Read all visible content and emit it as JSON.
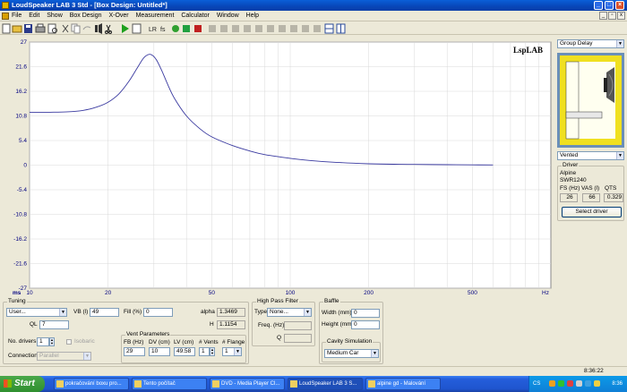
{
  "window": {
    "title": "LoudSpeaker LAB 3 Std - [Box Design: Untitled*]"
  },
  "menu": [
    "File",
    "Edit",
    "Show",
    "Box Design",
    "X-Over",
    "Measurement",
    "Calculator",
    "Window",
    "Help"
  ],
  "plot": {
    "logo": "LspLAB",
    "unit_label": "ms",
    "x_unit": "Hz"
  },
  "chart_data": {
    "type": "line",
    "title": "",
    "xlabel": "Hz",
    "ylabel": "ms",
    "x_scale": "log",
    "xlim": [
      10,
      1000
    ],
    "ylim": [
      -27,
      27
    ],
    "xticks": [
      10,
      20,
      50,
      100,
      200,
      500
    ],
    "yticks": [
      27,
      21.6,
      16.2,
      10.8,
      5.4,
      0,
      -5.4,
      -10.8,
      -16.2,
      -21.6,
      -27
    ],
    "ytick_labels": [
      "27",
      "21.6",
      "16.2",
      "10.8",
      "5.4",
      "0",
      "-5.4",
      "-10.8",
      "-16.2",
      "-21.6",
      "-27"
    ],
    "grid": true,
    "legend": "none",
    "line_color": "#3a3aa0",
    "series": [
      {
        "x": [
          10,
          12,
          14,
          16,
          18,
          20,
          22,
          24,
          26,
          27.5,
          29,
          30.5,
          32,
          34,
          36,
          40,
          45,
          50,
          60,
          70,
          80,
          100,
          120,
          150,
          200,
          250,
          300,
          400,
          500,
          600
        ],
        "values": [
          11.6,
          11.6,
          11.7,
          12,
          12.7,
          13.8,
          15.6,
          18.3,
          21.5,
          23.6,
          24.3,
          23.3,
          21,
          17.5,
          14.6,
          10.8,
          8,
          6.2,
          4.3,
          3.1,
          2.3,
          1.5,
          1,
          0.6,
          0.3,
          0.2,
          0.15,
          0.1,
          0.05,
          0.03
        ]
      }
    ]
  },
  "right": {
    "view_select": "Group Delay",
    "box_type_select": "Vented",
    "driver": {
      "group_label": "Driver",
      "brand": "Alpine",
      "model": "SWR1240",
      "fs_label": "FS (Hz)",
      "vas_label": "VAS (l)",
      "qts_label": "QTS",
      "fs": "26",
      "vas": "66",
      "qts": "0.329",
      "select_button": "Select driver"
    }
  },
  "tuning": {
    "label": "Tuning",
    "preset": "User...",
    "vb_label": "VB (l)",
    "vb": "49",
    "fill_label": "Fill (%)",
    "fill": "0",
    "alpha_label": "alpha",
    "alpha": "1.3469",
    "h_label": "H",
    "h": "1.1154",
    "ql_label": "QL",
    "ql": "7",
    "drivers_label": "No. drivers",
    "drivers": "1",
    "isobaric_label": "Isobaric",
    "connection_label": "Connection",
    "connection": "Parallel"
  },
  "vent": {
    "label": "Vent Parameters",
    "fb_label": "FB (Hz)",
    "dv_label": "DV (cm)",
    "lv_label": "LV (cm)",
    "nvents_label": "# Vents",
    "flange_label": "# Flange",
    "fb": "29",
    "dv": "10",
    "lv": "49.58",
    "nvents": "1",
    "flange": "1"
  },
  "hpf": {
    "label": "High Pass Filter",
    "type_label": "Type",
    "type": "None...",
    "freq_label": "Freq. (Hz)",
    "q_label": "Q"
  },
  "baffle": {
    "label": "Baffle",
    "width_label": "Width (mm)",
    "width": "0",
    "height_label": "Height (mm)",
    "height": "0",
    "cavity_label": "Cavity Simulation",
    "cavity": "Medium Car"
  },
  "status": {
    "time": "8:36:22"
  },
  "taskbar": {
    "start": "Start",
    "tasks": [
      "pokračování boxu pro...",
      "Tento počítač",
      "DVD - Media Player Cl...",
      "LoudSpeaker LAB 3 S...",
      "alpine gd - Malování"
    ],
    "lang": "CS",
    "clock": "8:36"
  },
  "colors": {
    "plot_background": "#ffffff",
    "grid": "#d8d8d8",
    "axis_text": "#000080",
    "curve": "#3a3aa0",
    "taskbar": "#245edb",
    "start": "#2f8f2f"
  }
}
